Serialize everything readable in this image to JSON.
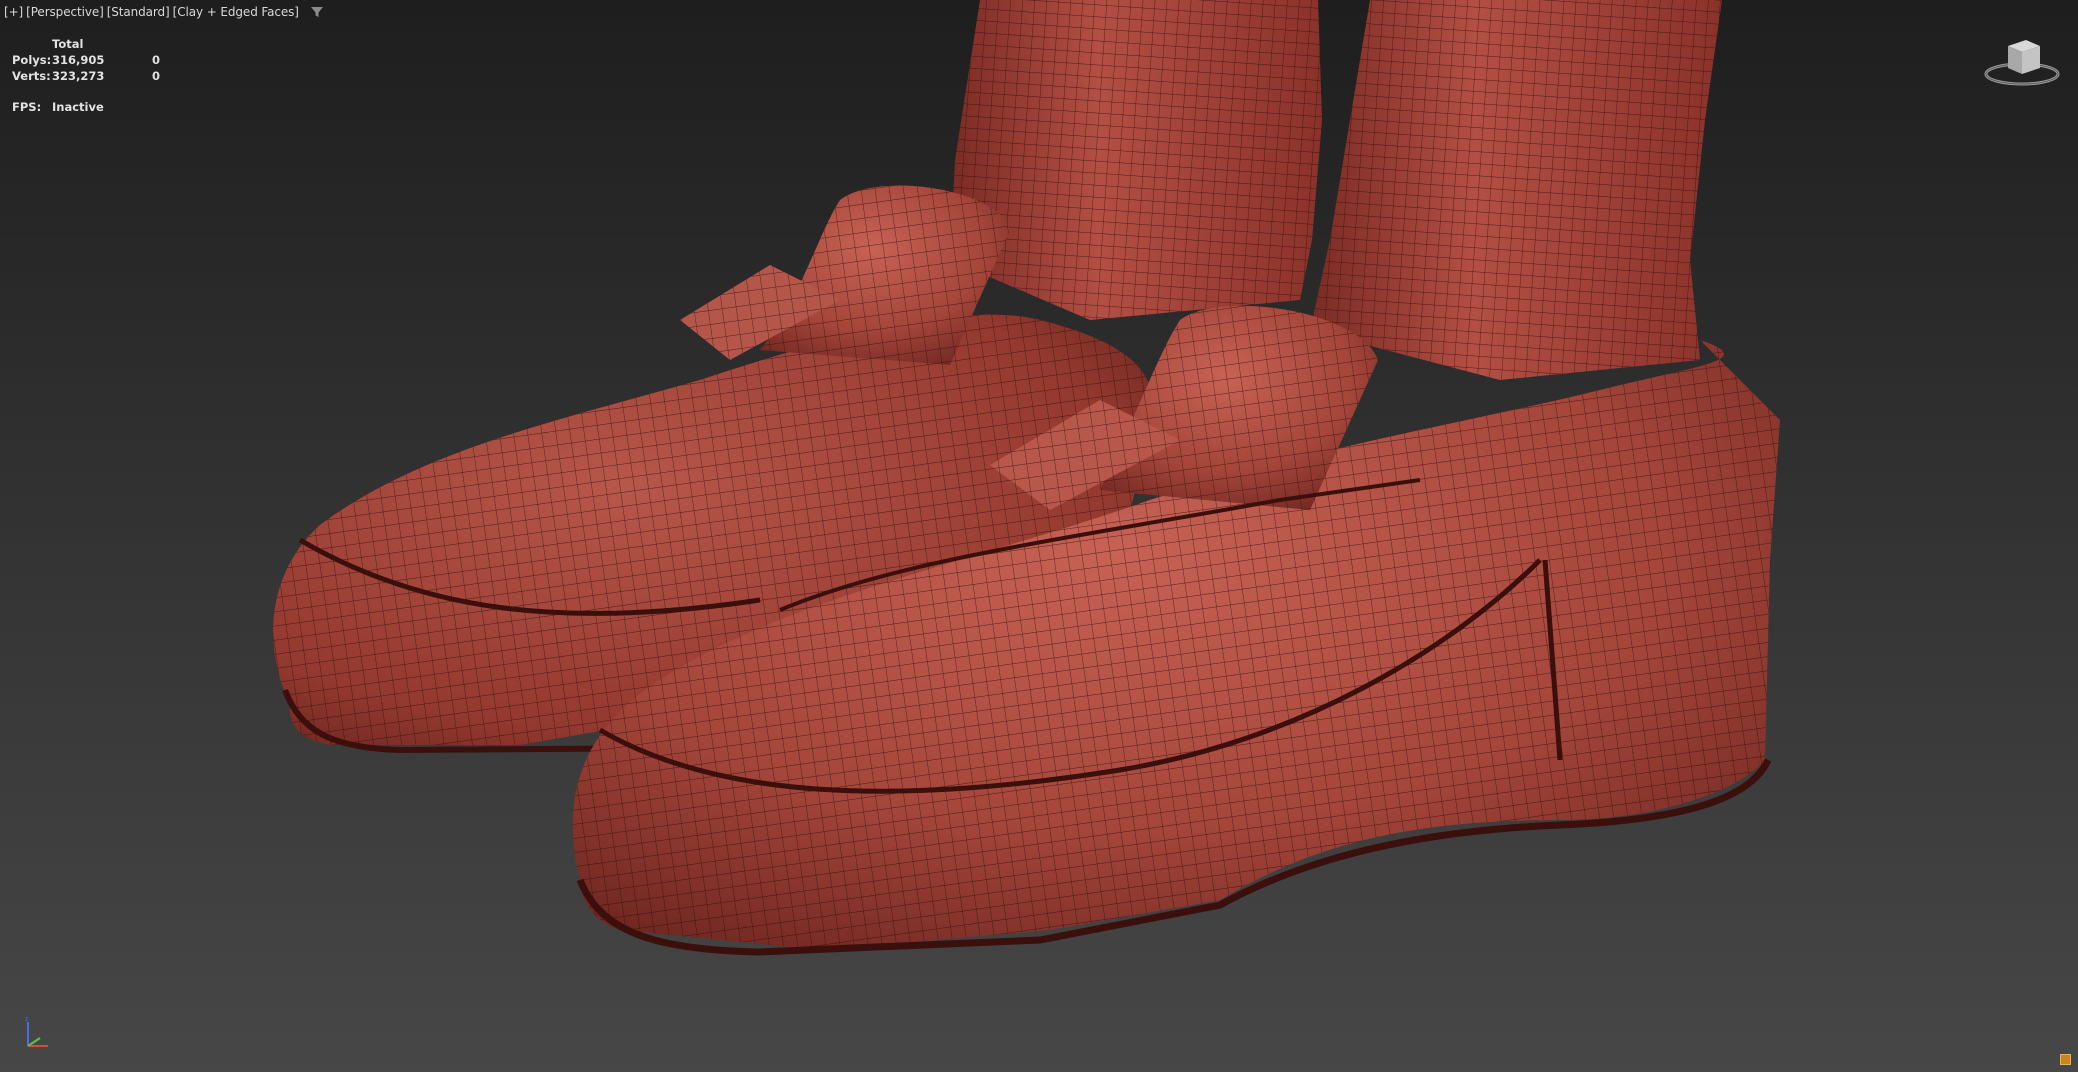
{
  "viewport": {
    "label_segments": [
      "[+]",
      "[Perspective]",
      "[Standard]",
      "[Clay + Edged Faces]"
    ],
    "filter_icon": "filter-funnel-icon",
    "accent_color": "#c9861e"
  },
  "stats": {
    "header": "Total",
    "polys_label": "Polys:",
    "polys_total": "316,905",
    "polys_selected": "0",
    "verts_label": "Verts:",
    "verts_total": "323,273",
    "verts_selected": "0"
  },
  "fps": {
    "label": "FPS:",
    "value": "Inactive"
  },
  "navigation": {
    "viewcube_icon": "viewcube-icon",
    "axis_icon": "axis-tripod-icon",
    "corner_icon": "viewport-layout-icon"
  },
  "model": {
    "material_color": "#a6443a",
    "wire_color": "#2a0a08"
  }
}
